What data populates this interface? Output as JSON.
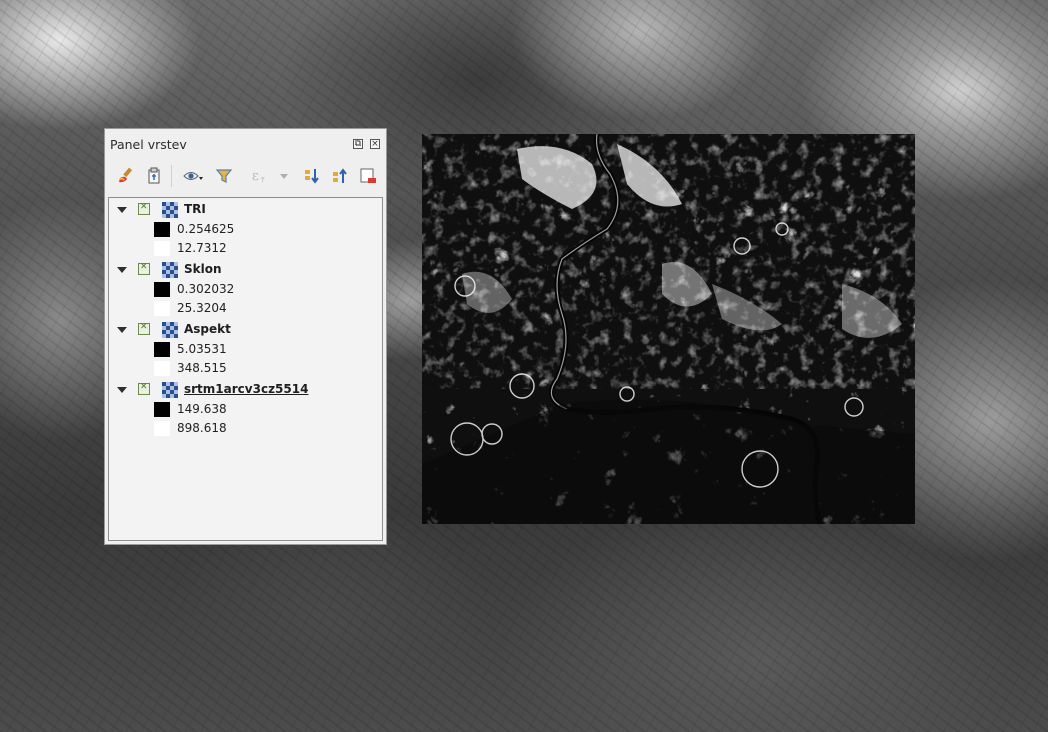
{
  "panel": {
    "title": "Panel vrstev",
    "toolbar": [
      {
        "icon": "paintbrush-icon"
      },
      {
        "icon": "add-group-icon"
      },
      {
        "icon": "eye-icon"
      },
      {
        "icon": "filter-icon"
      },
      {
        "icon": "expression-filter-icon"
      },
      {
        "icon": "expand-all-icon"
      },
      {
        "icon": "collapse-all-icon"
      },
      {
        "icon": "remove-layer-icon"
      }
    ],
    "layers": [
      {
        "name": "TRI",
        "min": "0.254625",
        "max": "12.7312",
        "active": false
      },
      {
        "name": "Sklon",
        "min": "0.302032",
        "max": "25.3204",
        "active": false
      },
      {
        "name": "Aspekt",
        "min": "5.03531",
        "max": "348.515",
        "active": false
      },
      {
        "name": "srtm1arcv3cz5514",
        "min": "149.638",
        "max": "898.618",
        "active": true
      }
    ]
  },
  "colors": {
    "checkbox_green": "#4e7a30",
    "raster_icon_dark": "#2b4f8a",
    "raster_icon_light": "#a9c2e6"
  }
}
